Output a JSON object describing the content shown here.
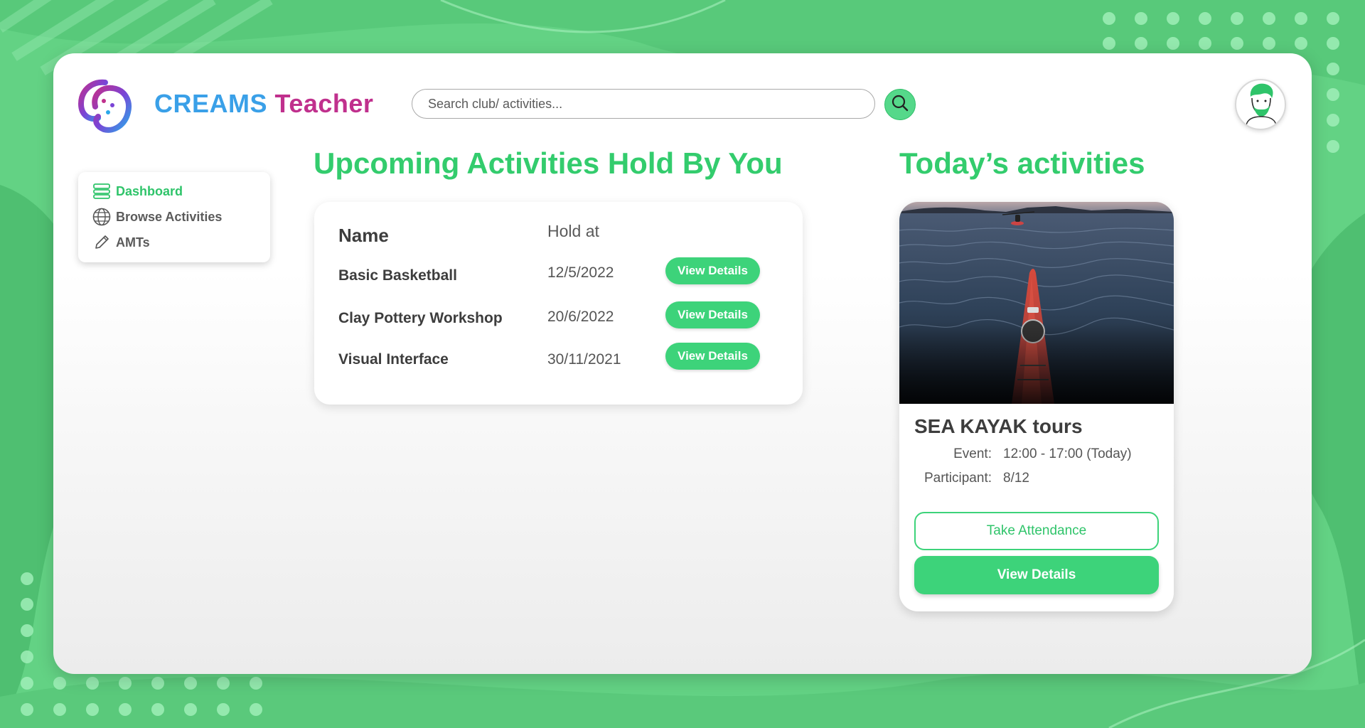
{
  "brand": {
    "part1": "CREAMS",
    "part2": "Teacher"
  },
  "search": {
    "placeholder": "Search club/ activities..."
  },
  "icons": {
    "logo": "creams-logo",
    "search": "search-icon",
    "avatar": "avatar-icon",
    "dashboard": "dashboard-icon",
    "browse": "globe-icon",
    "amts": "pencil-icon"
  },
  "colors": {
    "accent": "#33cc6d",
    "brand_blue": "#3aa0e8",
    "brand_magenta": "#c0308d",
    "background": "#5fcf7f"
  },
  "sidebar": {
    "items": [
      {
        "label": "Dashboard",
        "active": true
      },
      {
        "label": "Browse Activities",
        "active": false
      },
      {
        "label": "AMTs",
        "active": false
      }
    ]
  },
  "upcoming": {
    "heading": "Upcoming Activities Hold By You",
    "columns": [
      "Name",
      "Hold at"
    ],
    "rows": [
      {
        "name": "Basic Basketball",
        "date": "12/5/2022",
        "action": "View Details"
      },
      {
        "name": "Clay Pottery Workshop",
        "date": "20/6/2022",
        "action": "View Details"
      },
      {
        "name": "Visual Interface",
        "date": "30/11/2021",
        "action": "View Details"
      }
    ]
  },
  "today": {
    "heading": "Today’s activities",
    "card": {
      "title": "SEA KAYAK tours",
      "event_label": "Event:",
      "event_value": "12:00 - 17:00 (Today)",
      "participant_label": "Participant:",
      "participant_value": "8/12",
      "attendance_button": "Take Attendance",
      "details_button": "View Details"
    }
  }
}
